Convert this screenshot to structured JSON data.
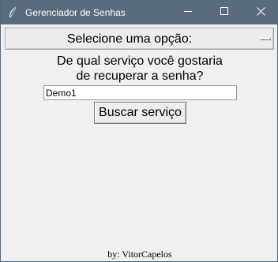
{
  "window": {
    "title": "Gerenciador de Senhas",
    "titlebar_color": "#5a6b7d",
    "icons": {
      "app": "feather-icon",
      "minimize": "minimize-icon",
      "maximize": "maximize-icon",
      "close": "close-icon"
    }
  },
  "option_menu": {
    "label": "Selecione uma opção:"
  },
  "question": {
    "line1": "De qual serviço você gostaria",
    "line2": "de recuperar a senha?"
  },
  "service_entry": {
    "value": "Demo1"
  },
  "search_button": {
    "label": "Buscar serviço"
  },
  "footer": {
    "credit": "by: VitorCapelos"
  }
}
